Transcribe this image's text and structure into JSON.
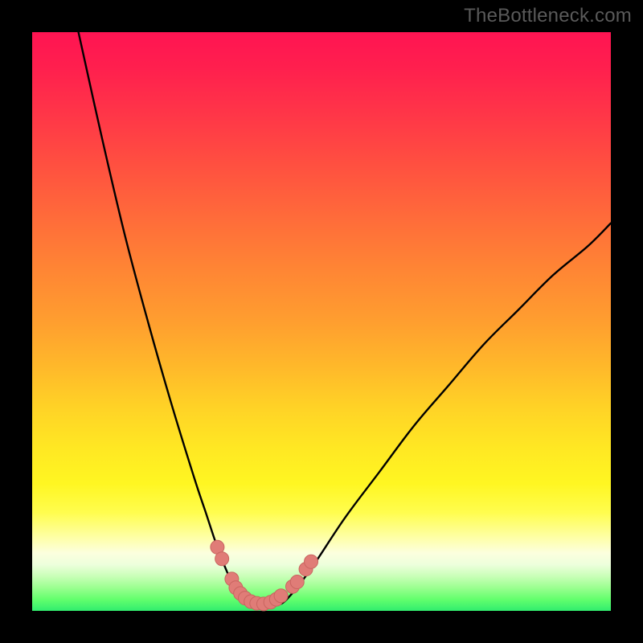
{
  "watermark": "TheBottleneck.com",
  "colors": {
    "frame": "#000000",
    "curve_stroke": "#000000",
    "marker_fill": "#e07c77",
    "marker_stroke": "#c96560"
  },
  "chart_data": {
    "type": "line",
    "title": "",
    "xlabel": "",
    "ylabel": "",
    "xlim": [
      0,
      100
    ],
    "ylim": [
      0,
      100
    ],
    "grid": false,
    "legend": false,
    "note": "no axis ticks or numeric labels present; values estimated from pixel positions on a 0-100 normalized axis",
    "series": [
      {
        "name": "left-branch",
        "x": [
          8,
          12,
          16,
          20,
          24,
          28,
          30,
          32,
          34,
          36
        ],
        "y": [
          100,
          82,
          65,
          50,
          36,
          23,
          17,
          11,
          6,
          2
        ]
      },
      {
        "name": "valley-floor",
        "x": [
          36,
          38,
          40,
          42,
          44
        ],
        "y": [
          2,
          1,
          1,
          1,
          2
        ]
      },
      {
        "name": "right-branch",
        "x": [
          44,
          48,
          54,
          60,
          66,
          72,
          78,
          84,
          90,
          96,
          100
        ],
        "y": [
          2,
          7,
          16,
          24,
          32,
          39,
          46,
          52,
          58,
          63,
          67
        ]
      }
    ],
    "markers": [
      {
        "name": "left-upper-1",
        "x": 32.0,
        "y": 11.0
      },
      {
        "name": "left-upper-2",
        "x": 32.8,
        "y": 9.0
      },
      {
        "name": "left-mid-1",
        "x": 34.5,
        "y": 5.5
      },
      {
        "name": "left-mid-2",
        "x": 35.2,
        "y": 4.0
      },
      {
        "name": "left-mid-3",
        "x": 36.0,
        "y": 3.0
      },
      {
        "name": "floor-1",
        "x": 36.8,
        "y": 2.2
      },
      {
        "name": "floor-2",
        "x": 37.8,
        "y": 1.6
      },
      {
        "name": "floor-3",
        "x": 38.8,
        "y": 1.3
      },
      {
        "name": "floor-4",
        "x": 40.0,
        "y": 1.2
      },
      {
        "name": "floor-5",
        "x": 41.2,
        "y": 1.5
      },
      {
        "name": "floor-6",
        "x": 42.2,
        "y": 2.0
      },
      {
        "name": "floor-7",
        "x": 43.0,
        "y": 2.6
      },
      {
        "name": "right-mid-1",
        "x": 45.0,
        "y": 4.2
      },
      {
        "name": "right-mid-2",
        "x": 45.8,
        "y": 5.0
      },
      {
        "name": "right-upper-1",
        "x": 47.3,
        "y": 7.2
      },
      {
        "name": "right-upper-2",
        "x": 48.2,
        "y": 8.5
      }
    ]
  }
}
